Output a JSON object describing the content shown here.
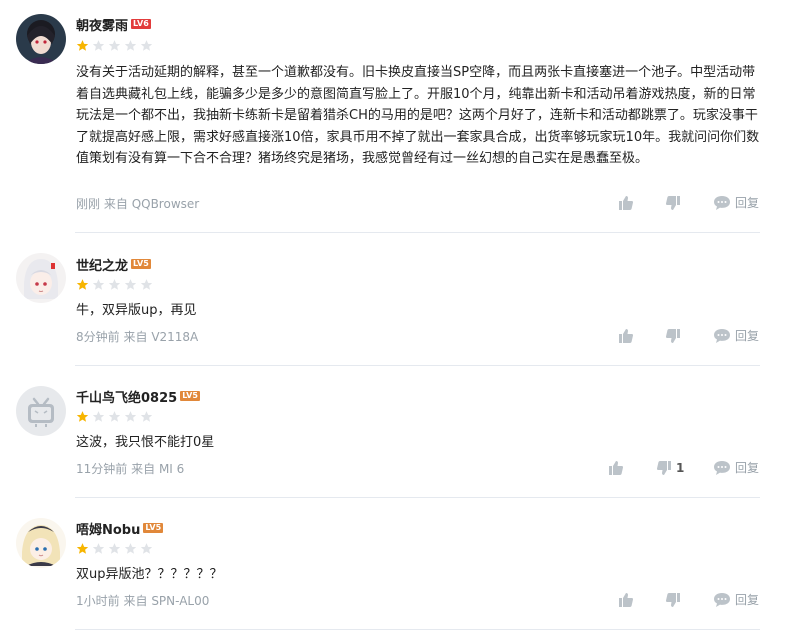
{
  "colors": {
    "level_badge": "#e16d39",
    "star_on": "#f7b500",
    "star_off": "#e0e3e7",
    "meta": "#99a2aa",
    "divider": "#e5e9ef"
  },
  "comments": [
    {
      "username": "朝夜雾雨",
      "level": "LV6",
      "rating": 1,
      "text": "没有关于活动延期的解释，甚至一个道歉都没有。旧卡换皮直接当SP空降，而且两张卡直接塞进一个池子。中型活动带着自选典藏礼包上线，能骗多少是多少的意图简直写脸上了。开服10个月，纯靠出新卡和活动吊着游戏热度，新的日常玩法是一个都不出，我抽新卡练新卡是留着猎杀CH的马用的是吧？这两个月好了，连新卡和活动都跳票了。玩家没事干了就提高好感上限，需求好感直接涨10倍，家具币用不掉了就出一套家具合成，出货率够玩家玩10年。我就问问你们数值策划有没有算一下合不合理？猪场终究是猪场，我感觉曾经有过一丝幻想的自己实在是愚蠢至极。",
      "time": "刚刚",
      "source_prefix": "来自",
      "source": "QQBrowser",
      "likes": "",
      "dislikes": "",
      "reply_label": "回复"
    },
    {
      "username": "世纪之龙",
      "level": "LV5",
      "rating": 1,
      "text": "牛，双异版up，再见",
      "time": "8分钟前",
      "source_prefix": "来自",
      "source": "V2118A",
      "likes": "",
      "dislikes": "",
      "reply_label": "回复"
    },
    {
      "username": "千山鸟飞绝0825",
      "level": "LV5",
      "rating": 1,
      "text": "这波，我只恨不能打0星",
      "time": "11分钟前",
      "source_prefix": "来自",
      "source": "MI 6",
      "likes": "",
      "dislikes": "1",
      "reply_label": "回复"
    },
    {
      "username": "唔姆Nobu",
      "level": "LV5",
      "rating": 1,
      "text": "双up异版池？？？？？？",
      "time": "1小时前",
      "source_prefix": "来自",
      "source": "SPN-AL00",
      "likes": "",
      "dislikes": "",
      "reply_label": "回复"
    }
  ]
}
